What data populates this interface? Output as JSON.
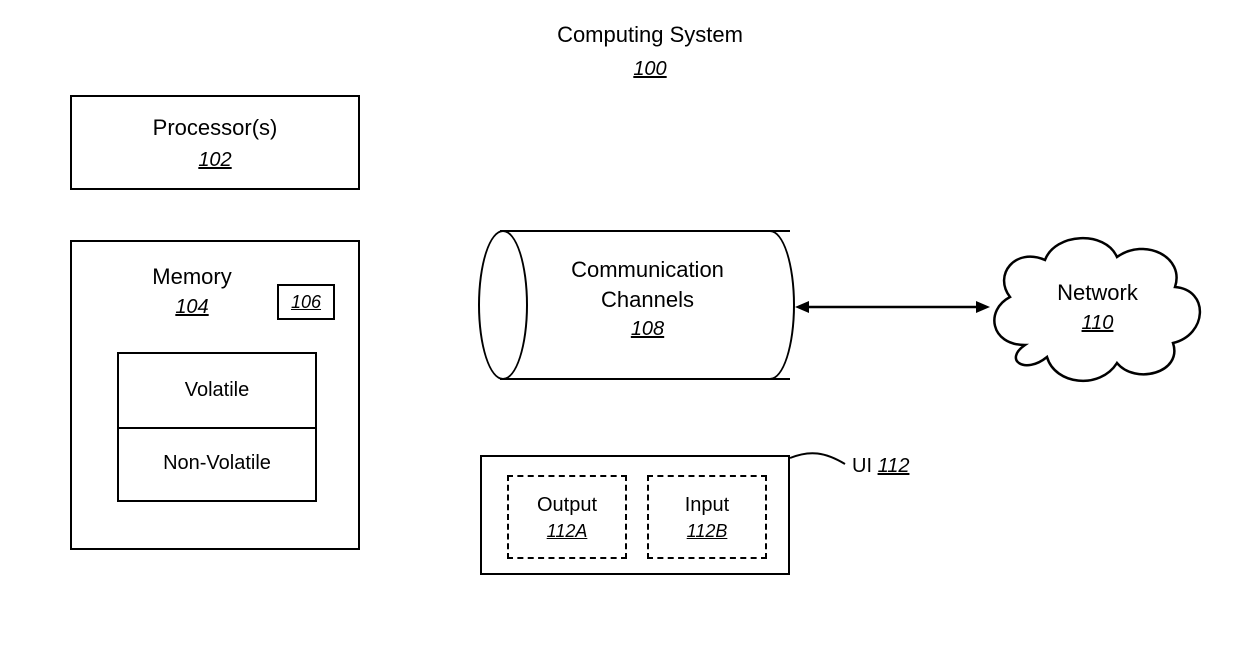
{
  "title": {
    "label": "Computing System",
    "ref": "100"
  },
  "processor": {
    "label": "Processor(s)",
    "ref": "102"
  },
  "memory": {
    "label": "Memory",
    "ref": "104",
    "chip_ref": "106",
    "volatile": "Volatile",
    "nonvolatile": "Non-Volatile"
  },
  "channels": {
    "label_line1": "Communication",
    "label_line2": "Channels",
    "ref": "108"
  },
  "network": {
    "label": "Network",
    "ref": "110"
  },
  "ui": {
    "label": "UI",
    "ref": "112",
    "output": {
      "label": "Output",
      "ref": "112A"
    },
    "input": {
      "label": "Input",
      "ref": "112B"
    }
  }
}
